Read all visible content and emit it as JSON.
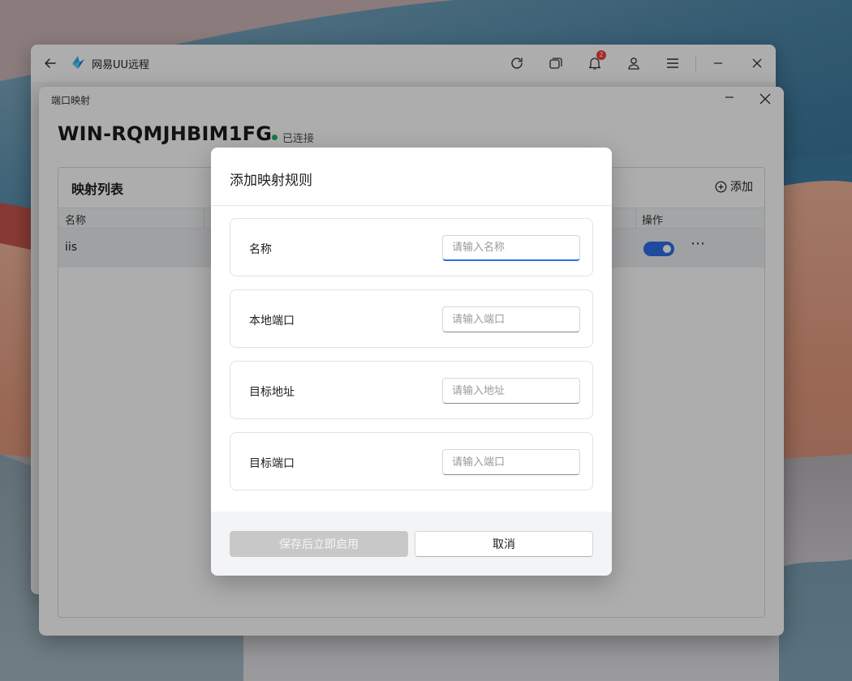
{
  "app": {
    "title": "网易UU远程",
    "notification_count": "2"
  },
  "port_mapping": {
    "window_title": "端口映射",
    "host_name": "WIN-RQMJHBIM1FG",
    "status": "已连接",
    "list_title": "映射列表",
    "add_label": "添加",
    "columns": {
      "name": "名称",
      "actions": "操作"
    },
    "rows": [
      {
        "name": "iis",
        "enabled": true
      }
    ]
  },
  "dialog": {
    "title": "添加映射规则",
    "fields": [
      {
        "label": "名称",
        "placeholder": "请输入名称"
      },
      {
        "label": "本地端口",
        "placeholder": "请输入端口"
      },
      {
        "label": "目标地址",
        "placeholder": "请输入地址"
      },
      {
        "label": "目标端口",
        "placeholder": "请输入端口"
      }
    ],
    "save_label": "保存后立即启用",
    "cancel_label": "取消"
  },
  "colors": {
    "accent": "#2f6ee8",
    "status_ok": "#21b36a",
    "badge": "#f04040",
    "disabled_button": "#c8c8c8"
  }
}
